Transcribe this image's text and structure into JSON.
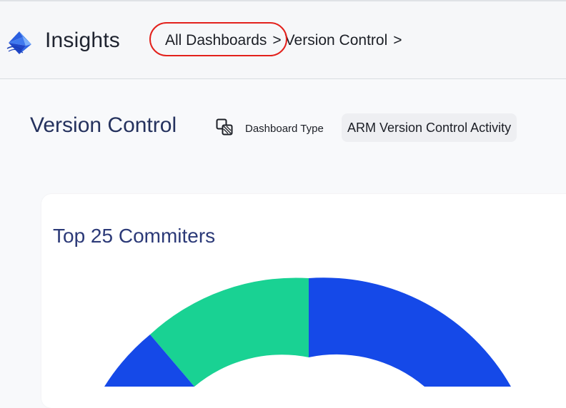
{
  "app": {
    "title": "Insights"
  },
  "breadcrumb": {
    "items": [
      {
        "label": "All Dashboards"
      },
      {
        "label": "Version Control"
      }
    ],
    "separator": ">"
  },
  "page": {
    "title": "Version Control",
    "dashboard_type_label": "Dashboard Type",
    "dashboard_type_value": "ARM Version Control Activity"
  },
  "card": {
    "title": "Top 25 Commiters"
  },
  "colors": {
    "slice_blue": "#1549e8",
    "slice_green": "#19d293",
    "annotation_ring": "#e3211c",
    "title_navy": "#25325e"
  },
  "chart_data": {
    "type": "pie",
    "title": "Top 25 Commiters",
    "visible_slice_colors": [
      "#1549e8",
      "#19d293",
      "#1549e8"
    ]
  }
}
